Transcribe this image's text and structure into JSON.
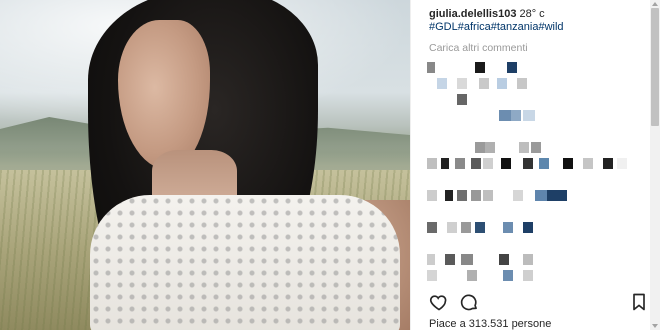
{
  "post": {
    "username": "giulia.delellis103",
    "caption_text": " 28° c",
    "hashtags": "#GDL#africa#tanzania#wild",
    "load_more": "Carica altri commenti",
    "likes_text": "Piace a 313.531 persone"
  },
  "pixelated_comments": [
    [
      [
        "#888888",
        0,
        8
      ],
      [
        "#1a1a1a",
        48,
        10
      ],
      [
        "#1e3f66",
        80,
        10
      ]
    ],
    [
      [
        "#c5d5e6",
        10,
        10
      ],
      [
        "#d9d9d9",
        30,
        10
      ],
      [
        "#c9c9c9",
        52,
        10
      ],
      [
        "#b9cde2",
        70,
        10
      ],
      [
        "#c7c7c7",
        90,
        10
      ]
    ],
    [
      [
        "#666666",
        30,
        10
      ]
    ],
    [
      [
        "#6c8db0",
        72,
        12
      ],
      [
        "#8ea9c5",
        84,
        10
      ],
      [
        "#c8d7e6",
        96,
        12
      ]
    ],
    [],
    [
      [
        "#9a9a9a",
        48,
        10
      ],
      [
        "#b0b0b0",
        58,
        10
      ],
      [
        "#bdbdbd",
        92,
        10
      ],
      [
        "#9a9a9a",
        104,
        10
      ]
    ],
    [
      [
        "#bfbfbf",
        0,
        10
      ],
      [
        "#222222",
        14,
        8
      ],
      [
        "#8a8a8a",
        28,
        10
      ],
      [
        "#5a5a5a",
        44,
        10
      ],
      [
        "#cfcfcf",
        56,
        10
      ],
      [
        "#111111",
        74,
        10
      ],
      [
        "#333333",
        96,
        10
      ],
      [
        "#5d87ad",
        112,
        10
      ],
      [
        "#111111",
        136,
        10
      ],
      [
        "#c5c5c5",
        156,
        10
      ],
      [
        "#222222",
        176,
        10
      ],
      [
        "#f0f0f0",
        190,
        10
      ]
    ],
    [],
    [
      [
        "#cccccc",
        0,
        10
      ],
      [
        "#222222",
        18,
        8
      ],
      [
        "#6f6f6f",
        30,
        10
      ],
      [
        "#999999",
        44,
        10
      ],
      [
        "#bfbfbf",
        56,
        10
      ],
      [
        "#d6d6d6",
        86,
        10
      ],
      [
        "#5f85ad",
        108,
        12
      ],
      [
        "#1e3f66",
        120,
        20
      ]
    ],
    [],
    [
      [
        "#6a6a6a",
        0,
        10
      ],
      [
        "#cfcfcf",
        20,
        10
      ],
      [
        "#999999",
        34,
        10
      ],
      [
        "#2d4f73",
        48,
        10
      ],
      [
        "#6c8db0",
        76,
        10
      ],
      [
        "#1e3f66",
        96,
        10
      ]
    ],
    [],
    [
      [
        "#cccccc",
        0,
        8
      ],
      [
        "#5a5a5a",
        18,
        10
      ],
      [
        "#888888",
        34,
        12
      ],
      [
        "#444444",
        72,
        10
      ],
      [
        "#bcbcbc",
        96,
        10
      ]
    ],
    [
      [
        "#d5d5d5",
        0,
        10
      ],
      [
        "#b0b0b0",
        40,
        10
      ],
      [
        "#6c8db0",
        76,
        10
      ],
      [
        "#cfcfcf",
        96,
        10
      ]
    ]
  ],
  "icons": [
    "heart-icon",
    "comment-icon",
    "bookmark-icon"
  ]
}
